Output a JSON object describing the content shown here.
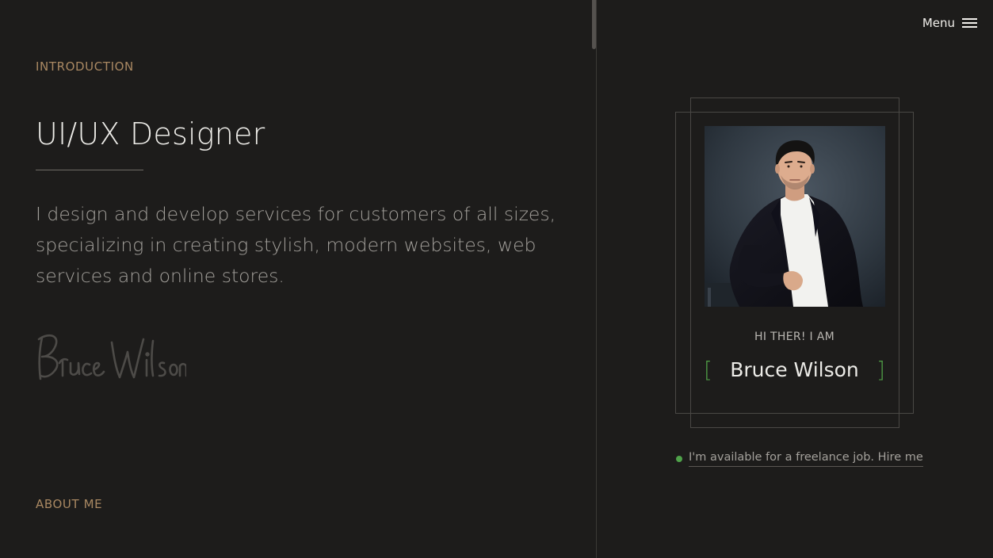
{
  "header": {
    "menu_label": "Menu",
    "menu_icon": "hamburger-icon"
  },
  "intro": {
    "section_label": "INTRODUCTION",
    "headline": "UI/UX Designer",
    "description": "I design and develop services for customers of all sizes, specializing in creating stylish, modern websites, web services and online stores.",
    "signature": "Bruce Wilson"
  },
  "about": {
    "section_label": "ABOUT ME"
  },
  "profile_card": {
    "greeting": "HI THER! I AM",
    "bracket_left": "[",
    "bracket_right": "]",
    "name": "Bruce Wilson",
    "availability_text": "I'm available for a freelance job. Hire me"
  },
  "colors": {
    "background": "#1d1c1b",
    "accent_gold": "#a98862",
    "accent_green": "#4e9a45",
    "text_primary": "#ecebe7",
    "text_muted": "#a3a09b"
  }
}
